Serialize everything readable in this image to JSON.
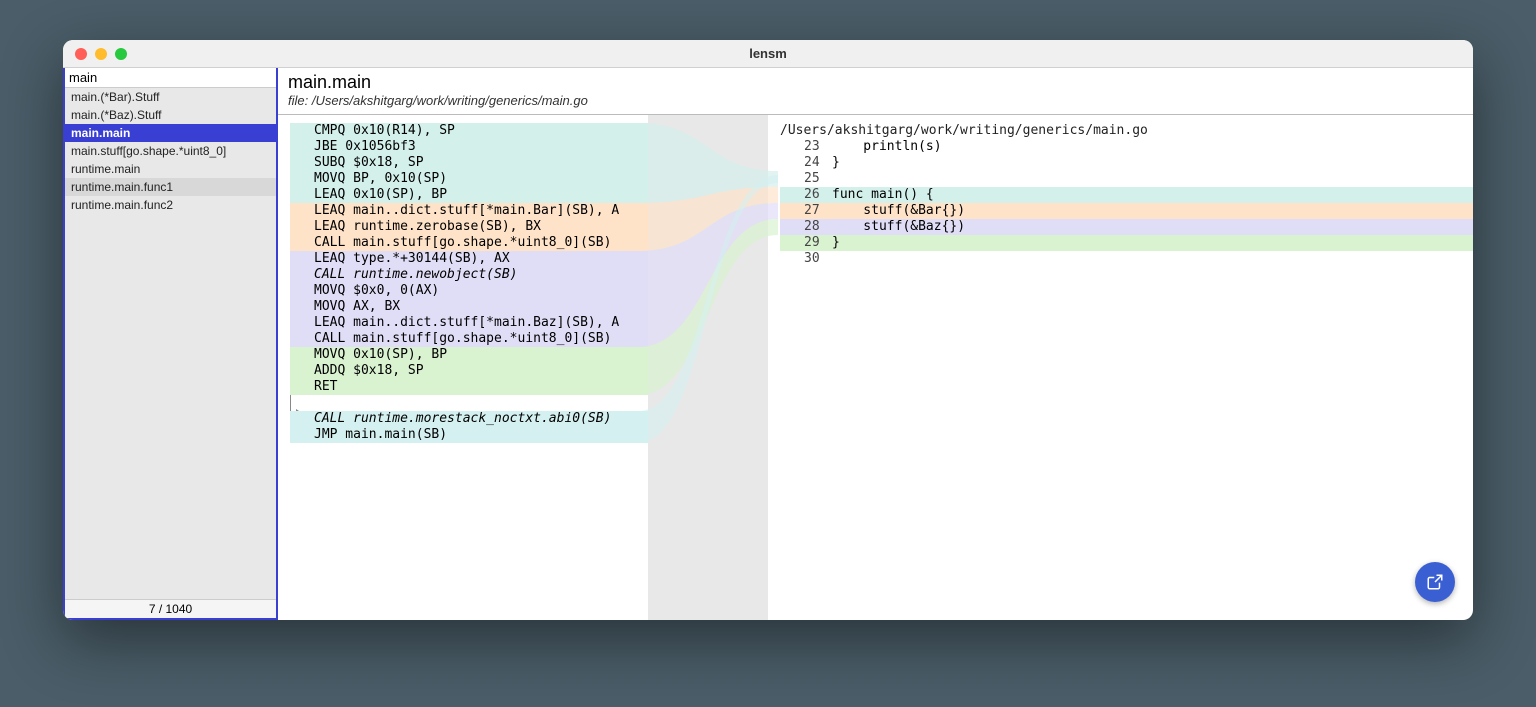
{
  "window": {
    "title": "lensm"
  },
  "sidebar": {
    "filter": "main",
    "items": [
      {
        "label": "main.(*Bar).Stuff",
        "state": ""
      },
      {
        "label": "main.(*Baz).Stuff",
        "state": ""
      },
      {
        "label": "main.main",
        "state": "sel"
      },
      {
        "label": "main.stuff[go.shape.*uint8_0]",
        "state": ""
      },
      {
        "label": "runtime.main",
        "state": ""
      },
      {
        "label": "runtime.main.func1",
        "state": "hover"
      },
      {
        "label": "runtime.main.func2",
        "state": ""
      }
    ],
    "counter": "7 / 1040"
  },
  "header": {
    "symbol": "main.main",
    "file_label": "file: /Users/akshitgarg/work/writing/generics/main.go"
  },
  "asm": [
    {
      "text": "CMPQ 0x10(R14), SP",
      "bg": "bg-teal"
    },
    {
      "text": "JBE 0x1056bf3",
      "bg": "bg-teal"
    },
    {
      "text": "SUBQ $0x18, SP",
      "bg": "bg-teal"
    },
    {
      "text": "MOVQ BP, 0x10(SP)",
      "bg": "bg-teal"
    },
    {
      "text": "LEAQ 0x10(SP), BP",
      "bg": "bg-teal"
    },
    {
      "text": "LEAQ main..dict.stuff[*main.Bar](SB), A",
      "bg": "bg-orange"
    },
    {
      "text": "LEAQ runtime.zerobase(SB), BX",
      "bg": "bg-orange"
    },
    {
      "text": "CALL main.stuff[go.shape.*uint8_0](SB)",
      "bg": "bg-orange"
    },
    {
      "text": "LEAQ type.*+30144(SB), AX",
      "bg": "bg-purple"
    },
    {
      "text": "CALL runtime.newobject(SB)",
      "bg": "bg-purple",
      "italic": true
    },
    {
      "text": "MOVQ $0x0, 0(AX)",
      "bg": "bg-purple"
    },
    {
      "text": "MOVQ AX, BX",
      "bg": "bg-purple"
    },
    {
      "text": "LEAQ main..dict.stuff[*main.Baz](SB), A",
      "bg": "bg-purple"
    },
    {
      "text": "CALL main.stuff[go.shape.*uint8_0](SB)",
      "bg": "bg-purple"
    },
    {
      "text": "MOVQ 0x10(SP), BP",
      "bg": "bg-green"
    },
    {
      "text": "ADDQ $0x18, SP",
      "bg": "bg-green"
    },
    {
      "text": "RET",
      "bg": "bg-green"
    },
    {
      "text": "",
      "bg": ""
    },
    {
      "text": "CALL runtime.morestack_noctxt.abi0(SB)",
      "bg": "bg-cyan",
      "italic": true
    },
    {
      "text": "JMP main.main(SB)",
      "bg": "bg-cyan"
    }
  ],
  "src": {
    "path": "/Users/akshitgarg/work/writing/generics/main.go",
    "lines": [
      {
        "n": "23",
        "text": "    println(s)",
        "bg": ""
      },
      {
        "n": "24",
        "text": "}",
        "bg": ""
      },
      {
        "n": "25",
        "text": "",
        "bg": ""
      },
      {
        "n": "26",
        "text": "func main() {",
        "bg": "bg-teal"
      },
      {
        "n": "27",
        "text": "    stuff(&Bar{})",
        "bg": "bg-orange"
      },
      {
        "n": "28",
        "text": "    stuff(&Baz{})",
        "bg": "bg-purple"
      },
      {
        "n": "29",
        "text": "}",
        "bg": "bg-green"
      },
      {
        "n": "30",
        "text": "",
        "bg": ""
      }
    ]
  },
  "colors": {
    "accent": "#3a3fd3",
    "fab": "#3a5fd3"
  }
}
